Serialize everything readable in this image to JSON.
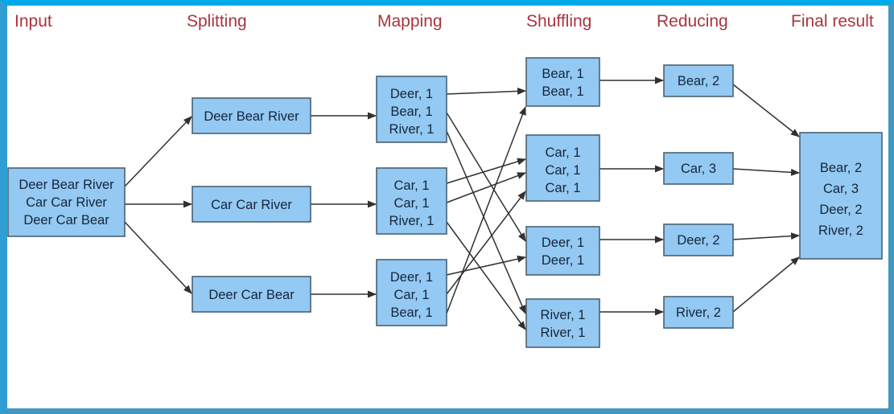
{
  "frame": {
    "border_top_color": "#00a9e8",
    "border_left_color": "#2f9ed3",
    "border_other_color": "#4097c0",
    "background_color": "#ffffff"
  },
  "theme": {
    "label_color": "#a83440",
    "box_fill": "#93c9f2",
    "box_stroke": "#4a6272",
    "text_color": "#17253a",
    "arrow_color": "#31302f"
  },
  "stages": [
    {
      "id": "input",
      "label": "Input"
    },
    {
      "id": "splitting",
      "label": "Splitting"
    },
    {
      "id": "mapping",
      "label": "Mapping"
    },
    {
      "id": "shuffling",
      "label": "Shuffling"
    },
    {
      "id": "reducing",
      "label": "Reducing"
    },
    {
      "id": "final",
      "label": "Final result"
    }
  ],
  "input": {
    "lines": [
      "Deer Bear River",
      "Car Car River",
      "Deer Car Bear"
    ]
  },
  "splitting": [
    {
      "lines": [
        "Deer Bear River"
      ]
    },
    {
      "lines": [
        "Car Car River"
      ]
    },
    {
      "lines": [
        "Deer Car Bear"
      ]
    }
  ],
  "mapping": [
    {
      "lines": [
        "Deer, 1",
        "Bear, 1",
        "River, 1"
      ]
    },
    {
      "lines": [
        "Car, 1",
        "Car, 1",
        "River, 1"
      ]
    },
    {
      "lines": [
        "Deer, 1",
        "Car, 1",
        "Bear, 1"
      ]
    }
  ],
  "shuffling": [
    {
      "lines": [
        "Bear, 1",
        "Bear, 1"
      ]
    },
    {
      "lines": [
        "Car, 1",
        "Car, 1",
        "Car, 1"
      ]
    },
    {
      "lines": [
        "Deer, 1",
        "Deer, 1"
      ]
    },
    {
      "lines": [
        "River, 1",
        "River, 1"
      ]
    }
  ],
  "reducing": [
    {
      "lines": [
        "Bear, 2"
      ]
    },
    {
      "lines": [
        "Car, 3"
      ]
    },
    {
      "lines": [
        "Deer, 2"
      ]
    },
    {
      "lines": [
        "River, 2"
      ]
    }
  ],
  "final": {
    "lines": [
      "Bear, 2",
      "Car, 3",
      "Deer, 2",
      "River, 2"
    ]
  }
}
